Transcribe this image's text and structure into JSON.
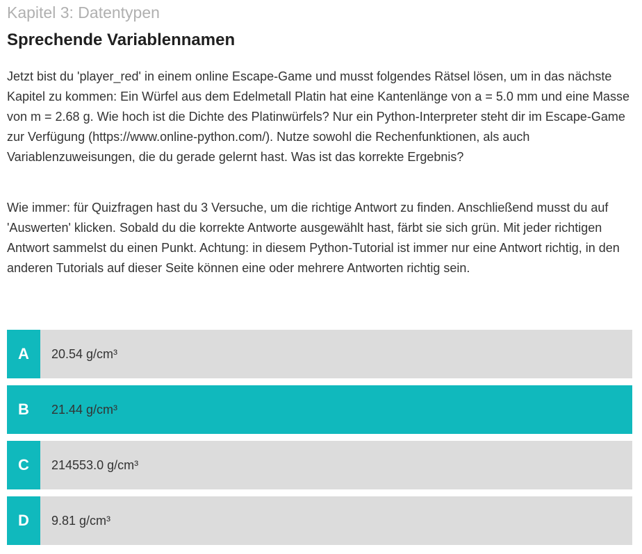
{
  "chapter": "Kapitel 3: Datentypen",
  "title": "Sprechende Variablennamen",
  "paragraphs": [
    "Jetzt bist du 'player_red' in einem online Escape-Game und musst folgendes Rätsel lösen, um in das nächste Kapitel zu kommen: Ein Würfel aus dem Edelmetall Platin hat eine Kantenlänge von a = 5.0 mm und eine Masse von m = 2.68 g. Wie hoch ist die Dichte des Platinwürfels? Nur ein Python-Interpreter steht dir im Escape-Game zur Verfügung (https://www.online-python.com/). Nutze sowohl die Rechenfunktionen, als auch Variablenzuweisungen, die du gerade gelernt hast. Was ist das korrekte Ergebnis?",
    "Wie immer: für Quizfragen hast du 3 Versuche, um die richtige Antwort zu finden. Anschließend musst du auf 'Auswerten' klicken. Sobald du die korrekte Antworte ausgewählt hast, färbt sie sich grün. Mit jeder richtigen Antwort sammelst du einen Punkt. Achtung: in diesem Python-Tutorial ist immer nur eine Antwort richtig, in den anderen Tutorials auf dieser Seite können eine oder mehrere Antworten richtig sein."
  ],
  "answers": [
    {
      "letter": "A",
      "text": "20.54 g/cm³",
      "selected": false
    },
    {
      "letter": "B",
      "text": "21.44 g/cm³",
      "selected": true
    },
    {
      "letter": "C",
      "text": "214553.0 g/cm³",
      "selected": false
    },
    {
      "letter": "D",
      "text": "9.81 g/cm³",
      "selected": false
    }
  ],
  "colors": {
    "accent": "#10b9bd",
    "answer_bg": "#dcdcdc",
    "chapter_text": "#b0b0b0"
  }
}
